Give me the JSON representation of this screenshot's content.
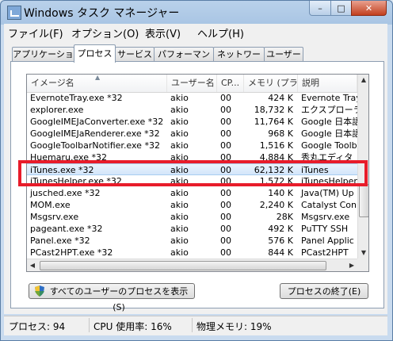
{
  "window": {
    "title": "Windows タスク マネージャー",
    "minimize_label": "–",
    "maximize_label": "□",
    "close_label": "✕"
  },
  "menu": [
    "ファイル(F)",
    "オプション(O)",
    "表示(V)",
    "ヘルプ(H)"
  ],
  "tabs": [
    "アプリケーション",
    "プロセス",
    "サービス",
    "パフォーマンス",
    "ネットワーク",
    "ユーザー"
  ],
  "active_tab": "プロセス",
  "columns": [
    "イメージ名",
    "ユーザー名",
    "CP...",
    "メモリ (プラ...",
    "説明"
  ],
  "rows": [
    [
      "EvernoteTray.exe *32",
      "akio",
      "00",
      "424 K",
      "Evernote Tray"
    ],
    [
      "explorer.exe",
      "akio",
      "00",
      "18,732 K",
      "エクスプローラー"
    ],
    [
      "GoogleIMEJaConverter.exe *32",
      "akio",
      "00",
      "11,764 K",
      "Google 日本語"
    ],
    [
      "GoogleIMEJaRenderer.exe *32",
      "akio",
      "00",
      "968 K",
      "Google 日本語"
    ],
    [
      "GoogleToolbarNotifier.exe *32",
      "akio",
      "00",
      "1,516 K",
      "Google Toolbar"
    ],
    [
      "Huemaru.exe *32",
      "akio",
      "00",
      "4,884 K",
      "秀丸エディタ"
    ],
    [
      "iTunes.exe *32",
      "akio",
      "00",
      "62,132 K",
      "iTunes"
    ],
    [
      "iTunesHelper.exe *32",
      "akio",
      "00",
      "1,572 K",
      "iTunesHelper"
    ],
    [
      "jusched.exe *32",
      "akio",
      "00",
      "140 K",
      "Java(TM) Up"
    ],
    [
      "MOM.exe",
      "akio",
      "00",
      "2,240 K",
      "Catalyst Con"
    ],
    [
      "Msgsrv.exe",
      "akio",
      "00",
      "28K",
      "Msgsrv.exe"
    ],
    [
      "pageant.exe *32",
      "akio",
      "00",
      "492 K",
      "PuTTY SSH"
    ],
    [
      "Panel.exe *32",
      "akio",
      "00",
      "576 K",
      "Panel Applic"
    ],
    [
      "PCast2HPT.exe *32",
      "akio",
      "00",
      "844 K",
      "PCast2HPT"
    ]
  ],
  "selected_row": "iTunes.exe *32",
  "buttons": {
    "show_all": "すべてのユーザーのプロセスを表示(S)",
    "end_process": "プロセスの終了(E)"
  },
  "status": {
    "processes": "プロセス: 94",
    "cpu": "CPU 使用率: 16%",
    "memory": "物理メモリ: 19%"
  },
  "colors": {
    "highlight_box": "#e81c2a",
    "selection": "#d3e6fa",
    "frame": "#b9d1ea"
  }
}
